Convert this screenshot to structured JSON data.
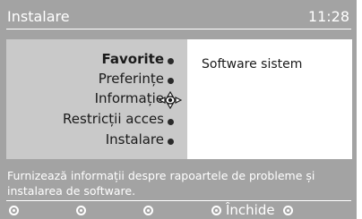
{
  "header": {
    "title": "Instalare",
    "clock": "11:28"
  },
  "menu": {
    "items": [
      {
        "label": "Favorite",
        "selected": true
      },
      {
        "label": "Preferințe",
        "selected": false
      },
      {
        "label": "Informație",
        "selected": false
      },
      {
        "label": "Restricții acces",
        "selected": false
      },
      {
        "label": "Instalare",
        "selected": false
      }
    ]
  },
  "info_panel": {
    "text": "Software sistem"
  },
  "status": {
    "help_text": "Furnizează informații despre rapoartele de probleme și instalarea de software."
  },
  "keys": {
    "close_label": "Închide"
  },
  "icons": {
    "navigator": "four-way-nav-icon"
  },
  "colors": {
    "bar": "#a3a3a3",
    "panel": "#c9c9c9"
  }
}
